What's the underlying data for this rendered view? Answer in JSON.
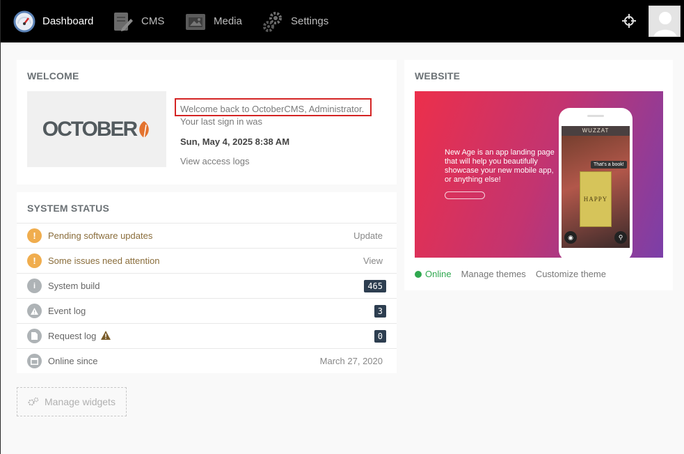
{
  "nav": {
    "items": [
      {
        "label": "Dashboard",
        "icon": "dashboard-icon"
      },
      {
        "label": "CMS",
        "icon": "cms-icon"
      },
      {
        "label": "Media",
        "icon": "media-icon"
      },
      {
        "label": "Settings",
        "icon": "settings-icon"
      }
    ]
  },
  "welcome": {
    "title": "WELCOME",
    "logo_text": "OCTOBER",
    "greeting": "Welcome back to OctoberCMS, Administrator.",
    "last_sign_in": "Your last sign in was",
    "last_sign_in_date": "Sun, May 4, 2025 8:38 AM",
    "access_logs": "View access logs"
  },
  "status": {
    "title": "SYSTEM STATUS",
    "rows": [
      {
        "label": "Pending software updates",
        "value": "Update"
      },
      {
        "label": "Some issues need attention",
        "value": "View"
      },
      {
        "label": "System build",
        "value": "465"
      },
      {
        "label": "Event log",
        "value": "3"
      },
      {
        "label": "Request log",
        "value": "0"
      },
      {
        "label": "Online since",
        "value": "March 27, 2020"
      }
    ]
  },
  "manage_widgets": "Manage widgets",
  "website": {
    "title": "WEBSITE",
    "preview": {
      "headline": "New Age is an app landing page that will help you beautifully showcase your new mobile app, or anything else!",
      "phone_title": "WUZZAT",
      "bubble": "That's a book!",
      "book": "HAPPY"
    },
    "status": "Online",
    "manage_themes": "Manage themes",
    "customize_theme": "Customize theme"
  },
  "colors": {
    "nav_bg": "#000000",
    "warning": "#f0ad4e",
    "online": "#2fa84f",
    "badge": "#2d3e50",
    "highlight_border": "#d42424"
  }
}
